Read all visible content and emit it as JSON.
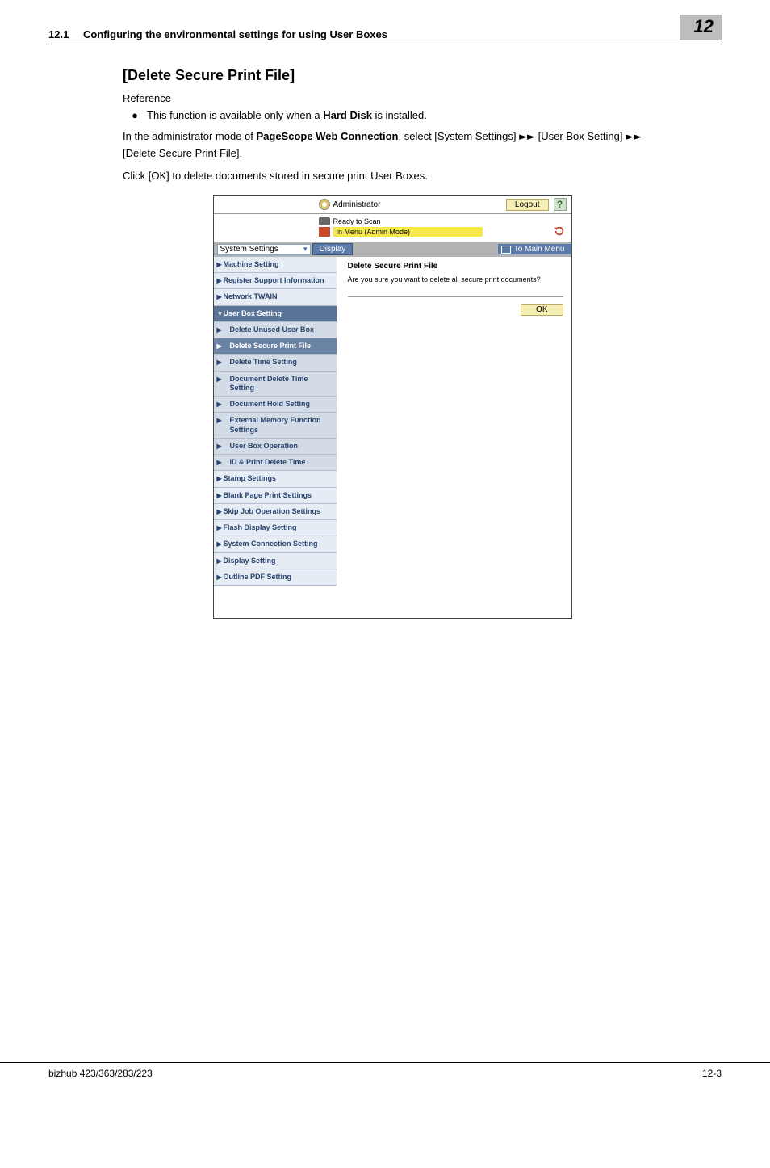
{
  "header": {
    "section_no": "12.1",
    "section_title": "Configuring the environmental settings for using User Boxes",
    "chapter": "12"
  },
  "doc": {
    "h_title": "[Delete Secure Print File]",
    "reference": "Reference",
    "bullet_pre": "This function is available only when a ",
    "bullet_bold": "Hard Disk",
    "bullet_post": " is installed.",
    "p1_a": "In the administrator mode of ",
    "p1_b": "PageScope Web Connection",
    "p1_c": ", select [System Settings] ",
    "p1_d": " [User Box Setting] ",
    "p1_e": " [Delete Secure Print File].",
    "p2": "Click [OK] to delete documents stored in secure print User Boxes.",
    "arrow": "►►"
  },
  "shot": {
    "admin": "Administrator",
    "logout": "Logout",
    "help": "?",
    "ready": "Ready to Scan",
    "menu_mode": "In Menu (Admin Mode)",
    "dropdown": "System Settings",
    "display": "Display",
    "to_main": "To Main Menu",
    "main_title": "Delete Secure Print File",
    "main_q": "Are you sure you want to delete all secure print documents?",
    "ok": "OK",
    "nav": [
      {
        "label": "Machine Setting",
        "type": "top"
      },
      {
        "label": "Register Support Information",
        "type": "top"
      },
      {
        "label": "Network TWAIN",
        "type": "top"
      },
      {
        "label": "User Box Setting",
        "type": "expanded"
      },
      {
        "label": "Delete Unused User Box",
        "type": "sub"
      },
      {
        "label": "Delete Secure Print File",
        "type": "sub active"
      },
      {
        "label": "Delete Time Setting",
        "type": "sub"
      },
      {
        "label": "Document Delete Time Setting",
        "type": "sub"
      },
      {
        "label": "Document Hold Setting",
        "type": "sub"
      },
      {
        "label": "External Memory Function Settings",
        "type": "sub"
      },
      {
        "label": "User Box Operation",
        "type": "sub"
      },
      {
        "label": "ID & Print Delete Time",
        "type": "sub"
      },
      {
        "label": "Stamp Settings",
        "type": "top"
      },
      {
        "label": "Blank Page Print Settings",
        "type": "top"
      },
      {
        "label": "Skip Job Operation Settings",
        "type": "top"
      },
      {
        "label": "Flash Display Setting",
        "type": "top"
      },
      {
        "label": "System Connection Setting",
        "type": "top"
      },
      {
        "label": "Display Setting",
        "type": "top"
      },
      {
        "label": "Outline PDF Setting",
        "type": "top"
      }
    ]
  },
  "footer": {
    "product": "bizhub 423/363/283/223",
    "page": "12-3"
  }
}
